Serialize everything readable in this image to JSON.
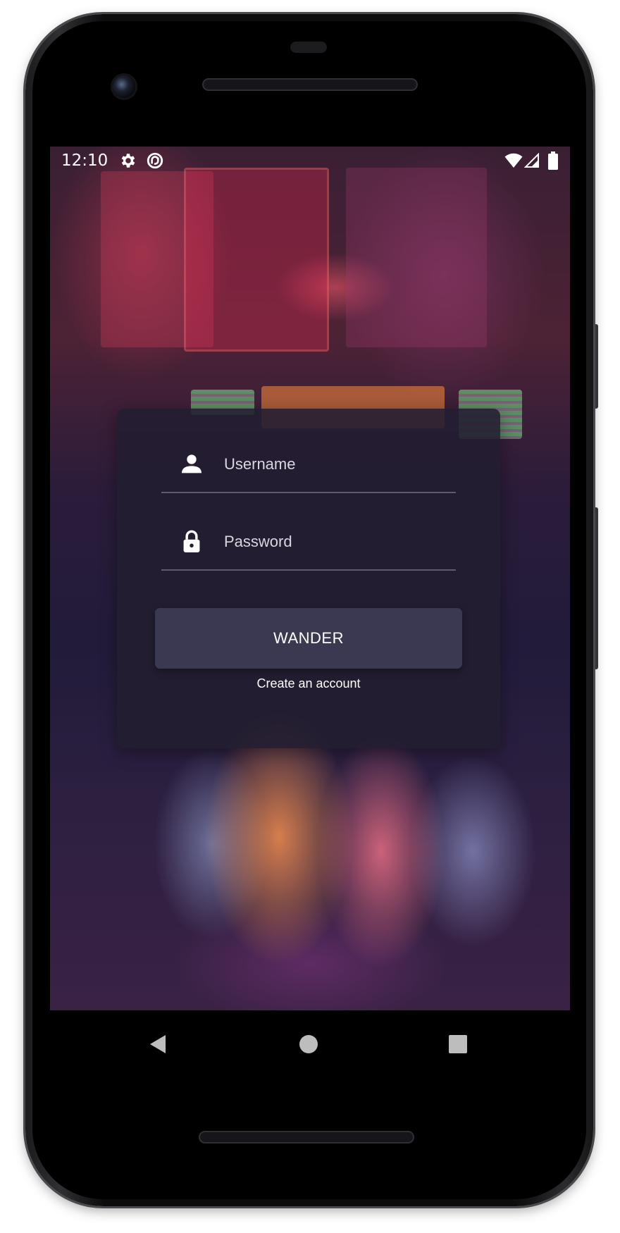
{
  "status_bar": {
    "time": "12:10",
    "icons": [
      "gear-icon",
      "sync-icon",
      "wifi-icon",
      "signal-icon",
      "battery-icon"
    ]
  },
  "login": {
    "username_placeholder": "Username",
    "username_value": "",
    "password_placeholder": "Password",
    "password_value": "",
    "submit_label": "WANDER",
    "create_account_label": "Create an account"
  },
  "nav_bar": {
    "icons": [
      "back-icon",
      "home-icon",
      "recents-icon"
    ]
  },
  "colors": {
    "card_background": "#221e30",
    "button_background": "#3b3951",
    "text": "#ffffff",
    "nav_icon": "#bdbdbd"
  }
}
